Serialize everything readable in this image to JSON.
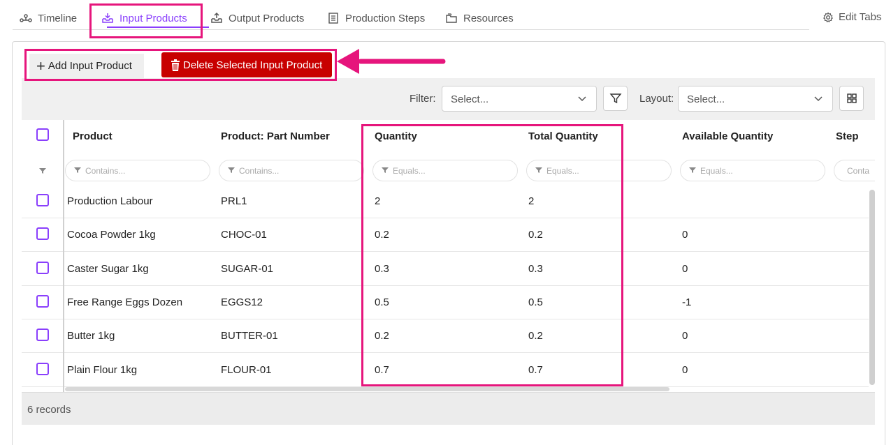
{
  "tabs": [
    {
      "label": "Timeline",
      "icon": "timeline-icon"
    },
    {
      "label": "Input Products",
      "icon": "tray-in-icon",
      "active": true
    },
    {
      "label": "Output Products",
      "icon": "tray-out-icon"
    },
    {
      "label": "Production Steps",
      "icon": "list-icon"
    },
    {
      "label": "Resources",
      "icon": "folders-icon"
    }
  ],
  "edit_tabs_label": "Edit Tabs",
  "toolbar": {
    "add_label": "Add Input Product",
    "delete_label": "Delete Selected Input Product"
  },
  "filterbar": {
    "filter_label": "Filter:",
    "filter_placeholder": "Select...",
    "layout_label": "Layout:",
    "layout_placeholder": "Select..."
  },
  "grid": {
    "columns": [
      "Product",
      "Product: Part Number",
      "Quantity",
      "Total Quantity",
      "Available Quantity",
      "Step"
    ],
    "filters": [
      "Contains...",
      "Contains...",
      "Equals...",
      "Equals...",
      "Equals...",
      "Conta"
    ],
    "rows": [
      [
        "Production Labour",
        "PRL1",
        "2",
        "2",
        "",
        ""
      ],
      [
        "Cocoa Powder 1kg",
        "CHOC-01",
        "0.2",
        "0.2",
        "0",
        ""
      ],
      [
        "Caster Sugar 1kg",
        "SUGAR-01",
        "0.3",
        "0.3",
        "0",
        ""
      ],
      [
        "Free Range Eggs Dozen",
        "EGGS12",
        "0.5",
        "0.5",
        "-1",
        ""
      ],
      [
        "Butter 1kg",
        "BUTTER-01",
        "0.2",
        "0.2",
        "0",
        ""
      ],
      [
        "Plain Flour 1kg",
        "FLOUR-01",
        "0.7",
        "0.7",
        "0",
        ""
      ]
    ]
  },
  "footer": {
    "records": "6 records"
  },
  "colors": {
    "accent": "#8a3ffc",
    "danger": "#c80000",
    "highlight": "#e6157c"
  }
}
